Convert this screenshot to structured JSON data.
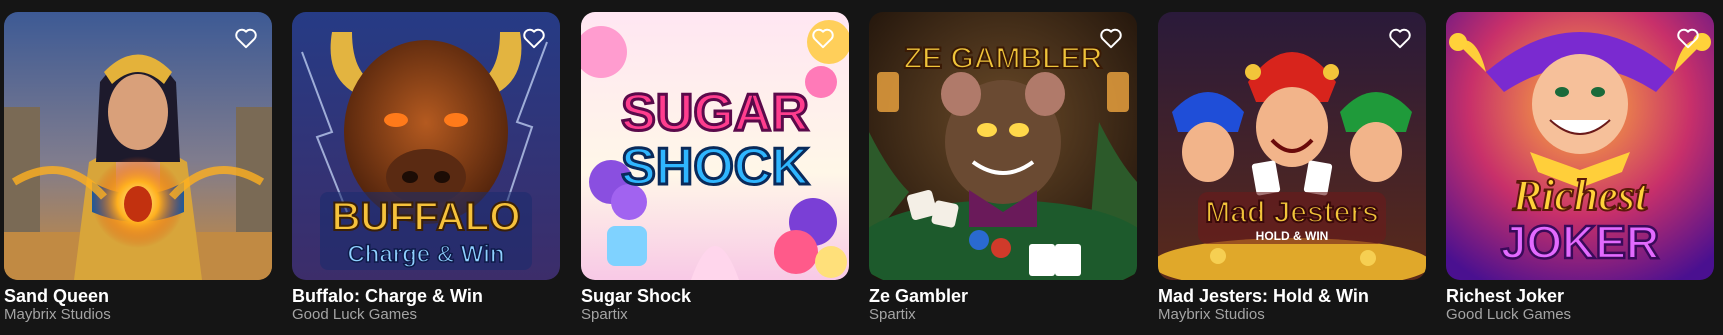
{
  "games": [
    {
      "title": "Sand Queen",
      "provider": "Maybrix Studios",
      "theme": "egypt-queen",
      "colors": {
        "bg1": "#3f5c96",
        "bg2": "#c98a3a",
        "accent": "#ffb01f"
      }
    },
    {
      "title": "Buffalo: Charge & Win",
      "provider": "Good Luck Games",
      "theme": "buffalo",
      "logo_lines": [
        "BUFFALO",
        "Charge & Win"
      ],
      "colors": {
        "bg1": "#2b3f86",
        "bg2": "#6a3412",
        "accent": "#f6c23c"
      }
    },
    {
      "title": "Sugar Shock",
      "provider": "Spartix",
      "theme": "candy",
      "logo_lines": [
        "SUGAR",
        "SHOCK"
      ],
      "colors": {
        "bg1": "#fde9f4",
        "bg2": "#a8d8ff",
        "accent": "#ff3d8e"
      }
    },
    {
      "title": "Ze Gambler",
      "provider": "Spartix",
      "theme": "rat-gambler",
      "logo_lines": [
        "ZE GAMBLER"
      ],
      "colors": {
        "bg1": "#3a2414",
        "bg2": "#1f4a2a",
        "accent": "#f0c43a"
      }
    },
    {
      "title": "Mad Jesters: Hold & Win",
      "provider": "Maybrix Studios",
      "theme": "jesters",
      "logo_lines": [
        "Mad Jesters",
        "HOLD & WIN"
      ],
      "colors": {
        "bg1": "#3a1540",
        "bg2": "#b8291e",
        "accent": "#f2c53a"
      }
    },
    {
      "title": "Richest Joker",
      "provider": "Good Luck Games",
      "theme": "joker",
      "logo_lines": [
        "Richest",
        "JOKER"
      ],
      "colors": {
        "bg1": "#6b1fa6",
        "bg2": "#ff7a1a",
        "accent": "#ffd23a"
      }
    }
  ],
  "icons": {
    "favorite": "heart-outline-icon"
  }
}
